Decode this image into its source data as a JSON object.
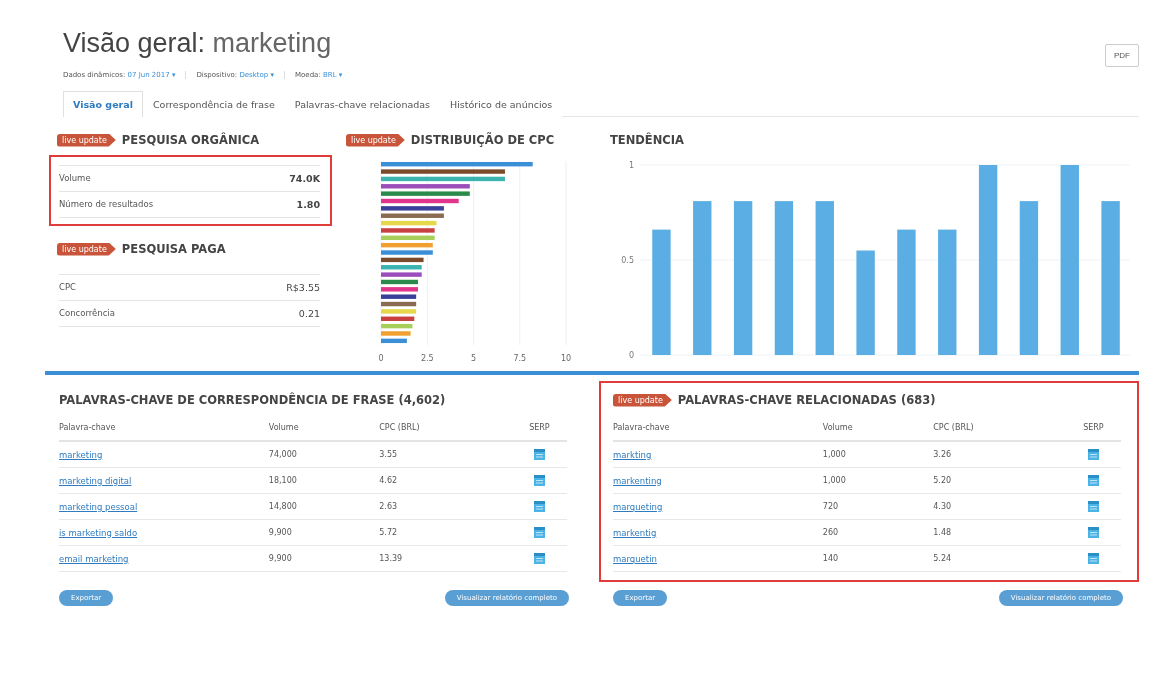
{
  "header": {
    "title": "Visão geral:",
    "keyword": "marketing",
    "pdf_button": "PDF",
    "filters": [
      {
        "label": "Dados dinâmicos:",
        "value": "07 Jun 2017",
        "caret": "▾"
      },
      {
        "label": "Dispositivo:",
        "value": "Desktop",
        "caret": "▾"
      },
      {
        "label": "Moeda:",
        "value": "BRL",
        "caret": "▾"
      }
    ]
  },
  "tabs": [
    {
      "label": "Visão geral",
      "selected": true
    },
    {
      "label": "Correspondência de frase",
      "selected": false
    },
    {
      "label": "Palavras-chave relacionadas",
      "selected": false
    },
    {
      "label": "Histórico de anúncios",
      "selected": false
    }
  ],
  "organic": {
    "badge": "live update",
    "title": "PESQUISA ORGÂNICA",
    "highlighted": true,
    "rows": [
      {
        "label": "Volume",
        "value": "74.0K",
        "bold": true
      },
      {
        "label": "Número de resultados",
        "value": "1.80",
        "bold": true
      }
    ]
  },
  "paid": {
    "badge": "live update",
    "title": "PESQUISA PAGA",
    "highlighted": false,
    "rows": [
      {
        "label": "CPC",
        "value": "R$3.55",
        "bold": false
      },
      {
        "label": "Concorrência",
        "value": "0.21",
        "bold": false
      }
    ]
  },
  "cpc_distribution": {
    "badge": "live update",
    "title": "DISTRIBUIÇÃO DE CPC",
    "chart_data": {
      "type": "bar",
      "orientation": "horizontal",
      "grid": true,
      "xlim": [
        0,
        10
      ],
      "xticks": [
        0,
        {
          "value": 2.5,
          "label": "2.5"
        },
        5,
        {
          "value": 7.5,
          "label": "7.5"
        },
        10
      ],
      "series": [
        {
          "colors": [
            "#3a8fd6",
            "#7a4a2a",
            "#3bb3b0",
            "#9b4dbb",
            "#2a8a4a",
            "#e0358a",
            "#3a3f9a",
            "#8a6a50",
            "#e6d84a",
            "#c84040",
            "#a8cf5a",
            "#f0a030",
            "#3a8fd6",
            "#7a4a2a",
            "#3bb3b0",
            "#9b4dbb",
            "#2a8a4a",
            "#e0358a",
            "#3a3f9a",
            "#8a6a50",
            "#e6d84a",
            "#c84040",
            "#a8cf5a",
            "#f0a030",
            "#3a8fd6"
          ],
          "values": [
            8.2,
            6.7,
            6.7,
            4.8,
            4.8,
            4.2,
            3.4,
            3.4,
            3.0,
            2.9,
            2.9,
            2.8,
            2.8,
            2.3,
            2.2,
            2.2,
            2.0,
            2.0,
            1.9,
            1.9,
            1.9,
            1.8,
            1.7,
            1.6,
            1.4
          ]
        }
      ]
    }
  },
  "trend": {
    "title": "TENDÊNCIA",
    "chart_data": {
      "type": "bar",
      "grid": true,
      "ylim": [
        0,
        1
      ],
      "yticks": [
        0,
        {
          "value": 0.5,
          "label": "0.5"
        },
        1
      ],
      "series": [
        {
          "color": "#5aaee3",
          "values": [
            0.66,
            0.81,
            0.81,
            0.81,
            0.81,
            0.55,
            0.66,
            0.66,
            1,
            0.81,
            1,
            0.81
          ]
        }
      ]
    }
  },
  "phrase_match": {
    "title": "PALAVRAS-CHAVE DE CORRESPONDÊNCIA DE FRASE (4,602)",
    "highlighted": false,
    "columns": [
      "Palavra-chave",
      "Volume",
      "CPC (BRL)",
      "SERP"
    ],
    "rows": [
      {
        "keyword": "marketing",
        "volume": "74,000",
        "cpc": "3.55"
      },
      {
        "keyword": "marketing digital",
        "volume": "18,100",
        "cpc": "4.62"
      },
      {
        "keyword": "marketing pessoal",
        "volume": "14,800",
        "cpc": "2.63"
      },
      {
        "keyword": "is marketing saldo",
        "volume": "9,900",
        "cpc": "5.72"
      },
      {
        "keyword": "email marketing",
        "volume": "9,900",
        "cpc": "13.39"
      }
    ],
    "export_button": "Exportar",
    "report_button": "Visualizar relatório completo"
  },
  "related": {
    "badge": "live update",
    "title": "PALAVRAS-CHAVE RELACIONADAS (683)",
    "highlighted": true,
    "columns": [
      "Palavra-chave",
      "Volume",
      "CPC (BRL)",
      "SERP"
    ],
    "rows": [
      {
        "keyword": "markting",
        "volume": "1,000",
        "cpc": "3.26"
      },
      {
        "keyword": "markenting",
        "volume": "1,000",
        "cpc": "5.20"
      },
      {
        "keyword": "marqueting",
        "volume": "720",
        "cpc": "4.30"
      },
      {
        "keyword": "markentig",
        "volume": "260",
        "cpc": "1.48"
      },
      {
        "keyword": "marquetin",
        "volume": "140",
        "cpc": "5.24"
      }
    ],
    "export_button": "Exportar",
    "report_button": "Visualizar relatório completo"
  }
}
